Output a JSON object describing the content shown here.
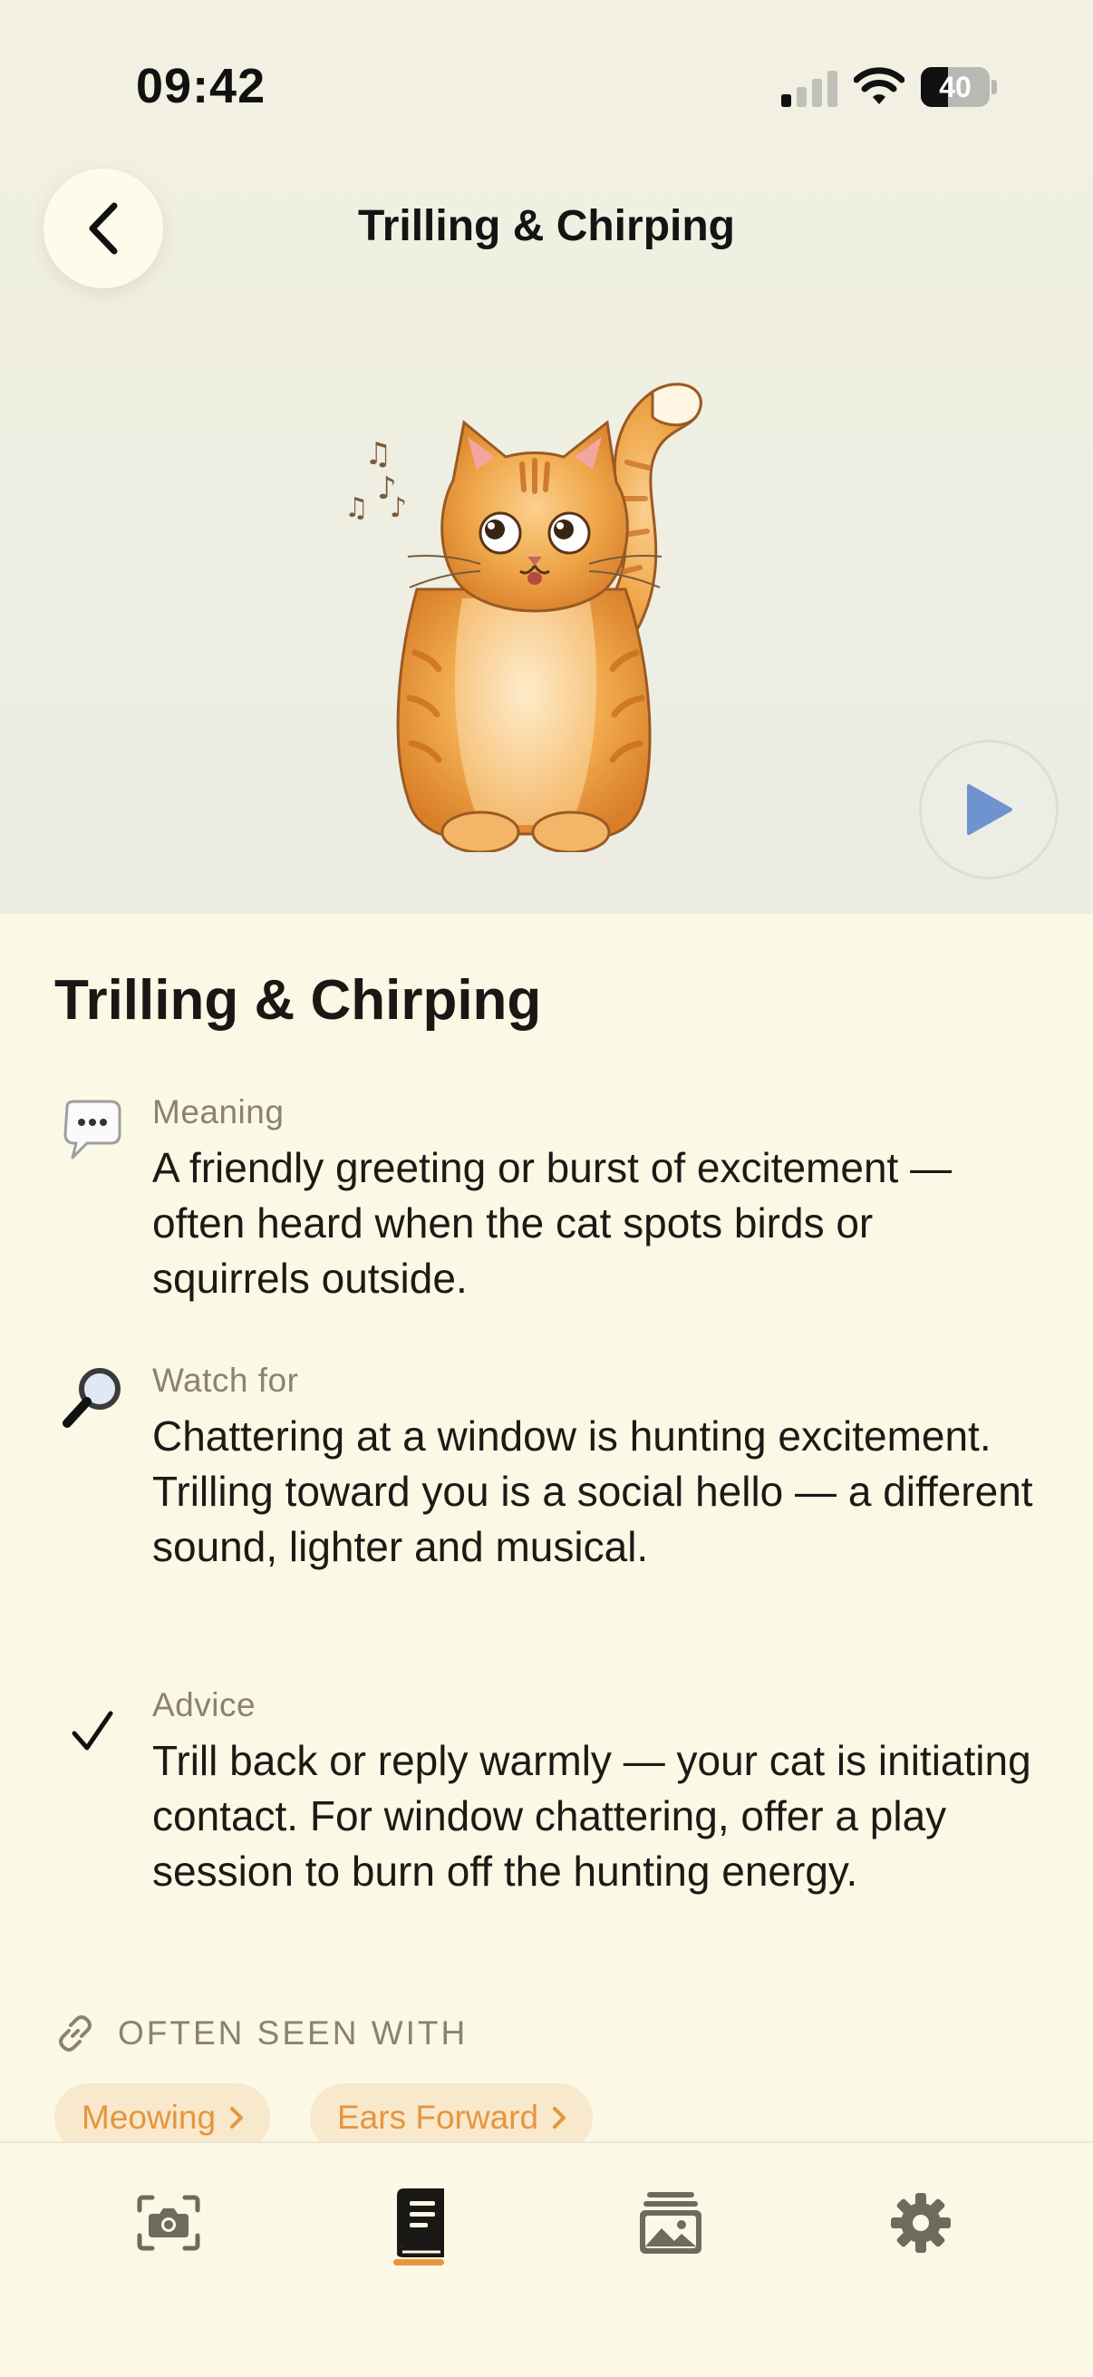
{
  "status_bar": {
    "time": "09:42",
    "battery_level": "40",
    "battery_fraction": 0.4
  },
  "header": {
    "title": "Trilling & Chirping",
    "back_icon": "chevron-left-icon",
    "play_icon": "play-icon"
  },
  "detail": {
    "title": "Trilling & Chirping",
    "sections": [
      {
        "icon": "speech-bubble-icon",
        "label": "Meaning",
        "text": "A friendly greeting or burst of excitement — often heard when the cat spots birds or squirrels outside."
      },
      {
        "icon": "magnifier-icon",
        "label": "Watch for",
        "text": "Chattering at a window is hunting excitement. Trilling toward you is a social hello — a different sound, lighter and musical."
      },
      {
        "icon": "checkmark-icon",
        "label": "Advice",
        "text": "Trill back or reply warmly — your cat is initiating contact. For window chattering, offer a play session to burn off the hunting energy."
      }
    ],
    "often_seen_with": {
      "label": "OFTEN SEEN WITH",
      "chips": [
        "Meowing",
        "Ears Forward"
      ]
    }
  },
  "tab_bar": {
    "tabs": [
      {
        "icon": "camera-icon"
      },
      {
        "icon": "book-icon",
        "active": true
      },
      {
        "icon": "gallery-icon"
      },
      {
        "icon": "gear-icon"
      }
    ]
  },
  "colors": {
    "background": "#fbf8e5",
    "accent": "#e5963e",
    "chip_background": "#f8e8cc",
    "play_blue": "#6f93cf"
  }
}
